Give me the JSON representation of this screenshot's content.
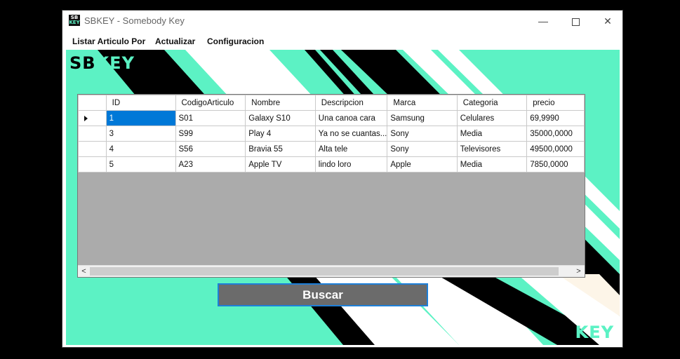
{
  "window": {
    "icon_lines": [
      "SB",
      "KEY"
    ],
    "title": "SBKEY - Somebody Key",
    "controls": {
      "minimize": "—",
      "close": "✕"
    }
  },
  "menu": {
    "items": [
      "Listar Articulo Por",
      "Actualizar",
      "Configuracion"
    ]
  },
  "logo": {
    "part1": "SB",
    "part2": "KEY",
    "brand_color": "#5cf2c4"
  },
  "grid": {
    "columns": [
      "ID",
      "CodigoArticulo",
      "Nombre",
      "Descripcion",
      "Marca",
      "Categoria",
      "precio"
    ],
    "rows": [
      [
        "1",
        "S01",
        "Galaxy S10",
        "Una canoa cara",
        "Samsung",
        "Celulares",
        "69,9990"
      ],
      [
        "3",
        "S99",
        "Play 4",
        "Ya no se cuantas...",
        "Sony",
        "Media",
        "35000,0000"
      ],
      [
        "4",
        "S56",
        "Bravia 55",
        "Alta tele",
        "Sony",
        "Televisores",
        "49500,0000"
      ],
      [
        "5",
        "A23",
        "Apple TV",
        "lindo loro",
        "Apple",
        "Media",
        "7850,0000"
      ]
    ],
    "scroll_left": "<",
    "scroll_right": ">"
  },
  "buttons": {
    "search_label": "Buscar"
  },
  "colors": {
    "accent": "#5cf2c4",
    "selection": "#0078d7",
    "button_bg": "#6b6b6b",
    "grid_empty": "#ababab"
  }
}
